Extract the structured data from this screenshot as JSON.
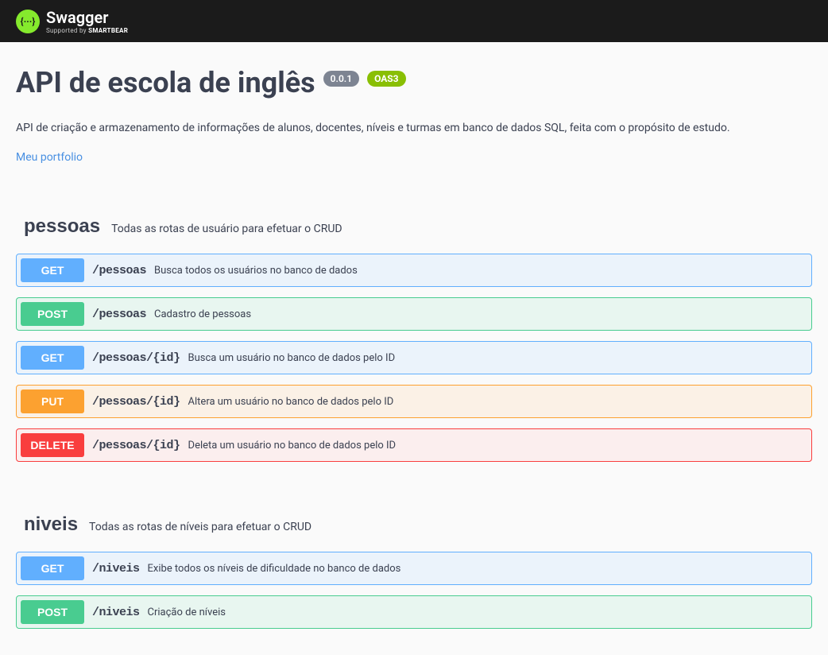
{
  "header": {
    "brand": "Swagger",
    "supported_by_prefix": "Supported by ",
    "supported_by_brand": "SMARTBEAR",
    "logo_glyph": "{···}"
  },
  "info": {
    "title": "API de escola de inglês",
    "version": "0.0.1",
    "oas": "OAS3",
    "description": "API de criação e armazenamento de informações de alunos, docentes, níveis e turmas em banco de dados SQL, feita com o propósito de estudo.",
    "portfolio_link": "Meu portfolio"
  },
  "tags": [
    {
      "name": "pessoas",
      "description": "Todas as rotas de usuário para efetuar o CRUD",
      "operations": [
        {
          "method": "GET",
          "path": "/pessoas",
          "summary": "Busca todos os usuários no banco de dados"
        },
        {
          "method": "POST",
          "path": "/pessoas",
          "summary": "Cadastro de pessoas"
        },
        {
          "method": "GET",
          "path": "/pessoas/{id}",
          "summary": "Busca um usuário no banco de dados pelo ID"
        },
        {
          "method": "PUT",
          "path": "/pessoas/{id}",
          "summary": "Altera um usuário no banco de dados pelo ID"
        },
        {
          "method": "DELETE",
          "path": "/pessoas/{id}",
          "summary": "Deleta um usuário no banco de dados pelo ID"
        }
      ]
    },
    {
      "name": "niveis",
      "description": "Todas as rotas de níveis para efetuar o CRUD",
      "operations": [
        {
          "method": "GET",
          "path": "/niveis",
          "summary": "Exibe todos os níveis de dificuldade no banco de dados"
        },
        {
          "method": "POST",
          "path": "/niveis",
          "summary": "Criação de níveis"
        }
      ]
    }
  ]
}
